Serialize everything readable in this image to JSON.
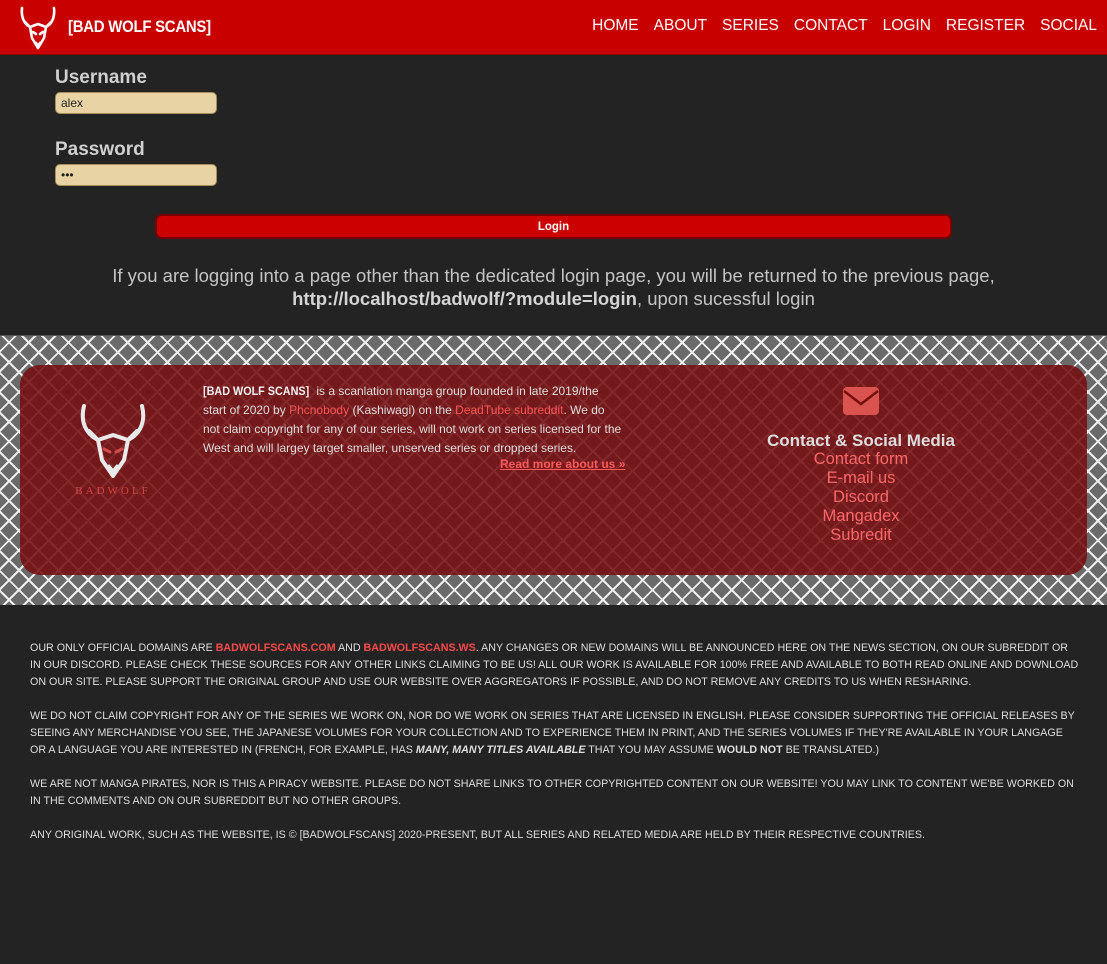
{
  "brand": {
    "name": "[BAD WOLF SCANS]",
    "logo_icon": "wolf-head-icon"
  },
  "nav": [
    "HOME",
    "ABOUT",
    "SERIES",
    "CONTACT",
    "LOGIN",
    "REGISTER",
    "SOCIAL"
  ],
  "login": {
    "username_label": "Username",
    "username_value": "alex",
    "password_label": "Password",
    "password_value": "•••",
    "button_label": "Login",
    "notice_line1": "If you are logging into a page other than the dedicated login page, you will be returned to the previous page,",
    "notice_url": "http://localhost/badwolf/?module=login",
    "notice_tail": ", upon sucessful login"
  },
  "footer": {
    "logo_text": "BADWOLF",
    "about": {
      "brand": "[BAD WOLF SCANS]",
      "p1": " is a scanlation manga group founded in late 2019/the start of 2020 by ",
      "founder_link": "Phcnobody",
      "p2": " (Kashiwagi) on the ",
      "subreddit_link": "DeadTube subreddit",
      "p3": ". We do not claim copyright for any of our series, will not work on series licensed for the West and will largey target smaller, unserved series or dropped series.",
      "read_more": "Read more about us »"
    },
    "contact": {
      "icon": "envelope-icon",
      "title": "Contact & Social Media",
      "links": [
        "Contact form",
        "E-mail us",
        "Discord",
        "Mangadex",
        "Subredit"
      ]
    }
  },
  "disclaimer": {
    "p1a": "Our only official domains are ",
    "domain1": "BADWOLFSCANS.COM",
    "p1b": " and ",
    "domain2": "BADWOLFSCANS.WS",
    "p1c": ". Any changes or new domains will be announced here on the news section, on our subreddit or in our discord. Please check these sources for any other links claiming to be us! All our work is available for 100% free and available to both read online and download on our site. Please support the original group and use our website over aggregators if possible, and do not remove any credits to us when resharing.",
    "p2a": "We do not claim copyright for any of the series we work on, nor do we work on series that are licensed in English. Please consider supporting the official releases by seeing any merchandise you see, the Japanese volumes for your collection and to experience them in print, and the series volumes if they're available in your langage or a language you are interested in (French, for example, has ",
    "p2b": "many, many titles available",
    "p2c": " that you may assume ",
    "p2d": "would not",
    "p2e": " be translated.)",
    "p3": "We are not manga pirates, nor is this a piracy website. Please do not share links to other copyrighted content on our website! You may link to content we'be worked on in the comments and on our subreddit but no other groups.",
    "p4": "Any original work, such as the website, is © [BadWolfScans] 2020-present, but all series and related media are held by their respective countries."
  },
  "colors": {
    "nav_red": "#c90000",
    "accent_red": "#ff4a4a",
    "background": "#232323",
    "panel": "#740e10"
  }
}
